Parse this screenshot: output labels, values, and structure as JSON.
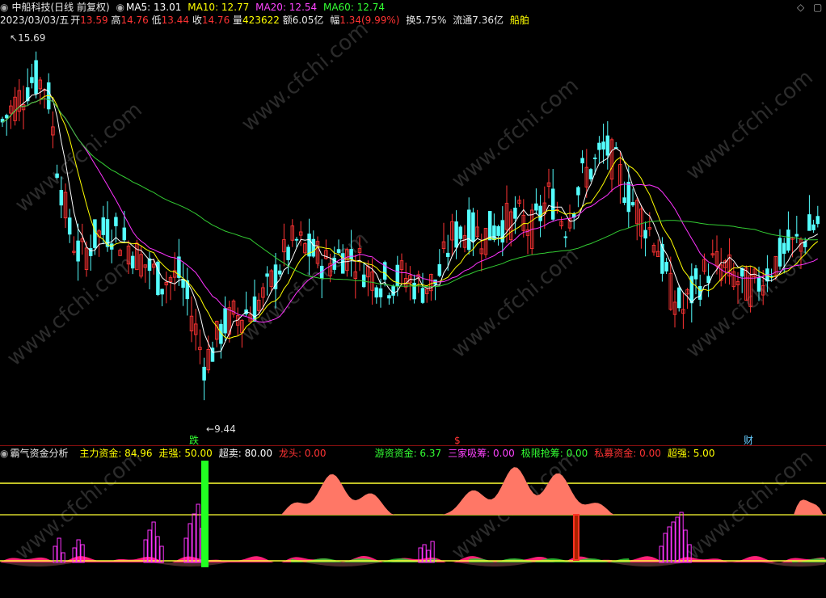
{
  "header": {
    "title": "中船科技(日线 前复权)",
    "ma5": "MA5: 13.01",
    "ma10": "MA10: 12.77",
    "ma20": "MA20: 12.54",
    "ma60": "MA60: 12.74",
    "date": "2023/03/03/五",
    "open_label": "开",
    "open": "13.59",
    "high_label": "高",
    "high": "14.76",
    "low_label": "低",
    "low": "13.44",
    "close_label": "收",
    "close": "14.76",
    "vol_label": "量",
    "vol": "423622",
    "amount_label": "额",
    "amount": "6.05亿",
    "change_label": "幅",
    "change": "1.34(9.99%)",
    "turnover_label": "换",
    "turnover": "5.75%",
    "float_label": "流通",
    "float": "7.36亿",
    "industry": "船舶"
  },
  "price_labels": {
    "high_mark": "15.69",
    "low_mark": "9.44"
  },
  "markers": {
    "m1": "跌",
    "m2": "$",
    "m3": "财"
  },
  "indicator": {
    "name": "霸气资金分析",
    "items": [
      {
        "label": "主力资金:",
        "value": "84.96",
        "color": "#ffff00"
      },
      {
        "label": "走强:",
        "value": "50.00",
        "color": "#ffff00"
      },
      {
        "label": "超卖:",
        "value": "80.00",
        "color": "#ffffff"
      },
      {
        "label": "龙头:",
        "value": "0.00",
        "color": "#ff3333"
      },
      {
        "label": "游资资金:",
        "value": "6.37",
        "color": "#33ff33"
      },
      {
        "label": "三家吸筹:",
        "value": "0.00",
        "color": "#ff44ff"
      },
      {
        "label": "极限抢筹:",
        "value": "0.00",
        "color": "#33ff33"
      },
      {
        "label": "私募资金:",
        "value": "0.00",
        "color": "#ff3333"
      },
      {
        "label": "超强:",
        "value": "5.00",
        "color": "#ffff00"
      }
    ]
  },
  "watermark": "www.cfchi.com",
  "colors": {
    "up": "#ff3333",
    "down": "#54ffff",
    "ma5": "#ffffff",
    "ma10": "#ffff00",
    "ma20": "#ff33ff",
    "ma60": "#33cc33",
    "fund": "#ff7766",
    "pink": "#ff2277"
  },
  "chart_data": {
    "type": "candlestick",
    "high": 15.69,
    "low": 9.44
  }
}
